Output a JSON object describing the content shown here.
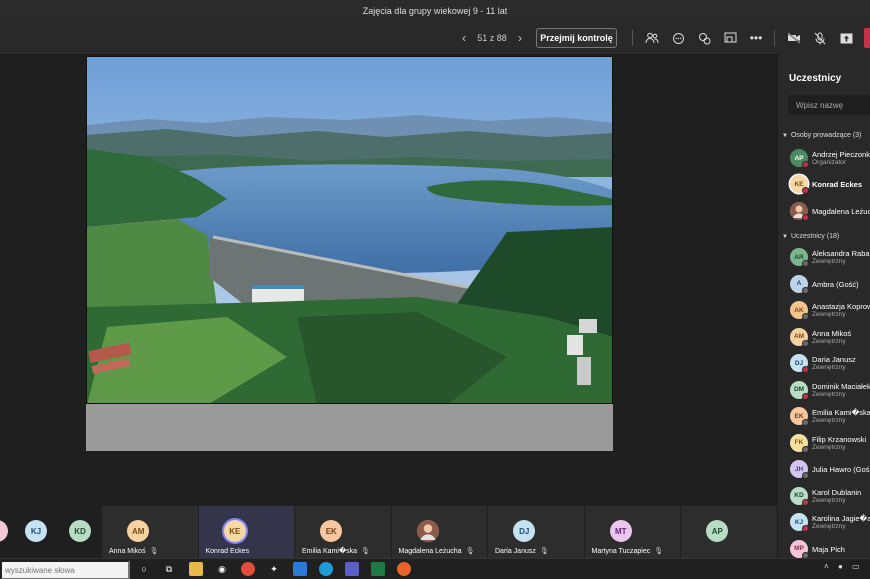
{
  "window": {
    "title": "Zajęcia dla grupy wiekowej 9 - 11 lat"
  },
  "toolbar": {
    "page_count": "51 z 88",
    "take_control": "Przejmij kontrolę",
    "icons": [
      "people-icon",
      "chat-icon",
      "reactions-icon",
      "share-tray-icon",
      "more-icon",
      "camera-off-icon",
      "mic-off-icon",
      "share-icon",
      "leave-icon"
    ]
  },
  "panel": {
    "title": "Uczestnicy",
    "search_placeholder": "Wpisz nazwę",
    "presenters_header": "Osoby prowadzące (3)",
    "presenters": [
      {
        "initials": "AP",
        "name": "Andrzej Pieczonka",
        "role": "Organizator",
        "color": "#4c8a63",
        "fg": "#fff"
      },
      {
        "initials": "KE",
        "name": "Konrad Eckes",
        "role": "",
        "color": "#f6d8a6",
        "fg": "#7a4a10"
      },
      {
        "initials": "",
        "name": "Magdalena Leżuch",
        "role": "",
        "color": "#c98a6a",
        "fg": "#fff"
      }
    ],
    "attendees_header": "Uczestnicy (18)",
    "attendees": [
      {
        "initials": "AR",
        "name": "Aleksandra Raba",
        "role": "Zewnętrzny",
        "color": "#7fb58c",
        "fg": "#1d4a2c"
      },
      {
        "initials": "A",
        "name": "Ambra (Gość)",
        "role": "",
        "color": "#bcd3ea",
        "fg": "#1f4a78"
      },
      {
        "initials": "AK",
        "name": "Anastazja Koprowska",
        "role": "Zewnętrzny",
        "color": "#f3c48e",
        "fg": "#7a4a10"
      },
      {
        "initials": "AM",
        "name": "Anna Mikoś",
        "role": "Zewnętrzny",
        "color": "#f6d2a2",
        "fg": "#7a4a10"
      },
      {
        "initials": "DJ",
        "name": "Daria Janusz",
        "role": "Zewnętrzny",
        "color": "#c6e2f0",
        "fg": "#1f4a78"
      },
      {
        "initials": "DM",
        "name": "Dominik Maciałek",
        "role": "Zewnętrzny",
        "color": "#b8dcc4",
        "fg": "#1d4a2c"
      },
      {
        "initials": "EK",
        "name": "Emilia Kami�ska",
        "role": "Zewnętrzny",
        "color": "#f6c7a0",
        "fg": "#7a3a10"
      },
      {
        "initials": "FK",
        "name": "Filip Krzanowski",
        "role": "Zewnętrzny",
        "color": "#f6e0a0",
        "fg": "#7a5a10"
      },
      {
        "initials": "JH",
        "name": "Julia Hawro (Gość)",
        "role": "",
        "color": "#d2c6ee",
        "fg": "#4a3a88"
      },
      {
        "initials": "KD",
        "name": "Karol Dublanin",
        "role": "Zewnętrzny",
        "color": "#b8dcc4",
        "fg": "#1d4a2c"
      },
      {
        "initials": "KJ",
        "name": "Karolina Jagie�a",
        "role": "Zewnętrzny",
        "color": "#c6e2f0",
        "fg": "#1f4a78"
      },
      {
        "initials": "MP",
        "name": "Maja Pich",
        "role": "",
        "color": "#f3c6d8",
        "fg": "#882a50"
      }
    ]
  },
  "strip": {
    "free": [
      {
        "initials": "KJ",
        "color": "#c6e2f0",
        "fg": "#1f4a78"
      },
      {
        "initials": "KD",
        "color": "#b8dcc4",
        "fg": "#1d4a2c"
      }
    ],
    "tiles": [
      {
        "initials": "AM",
        "name": "Anna Mikoś",
        "color": "#f6d2a2",
        "fg": "#7a4a10"
      },
      {
        "initials": "KE",
        "name": "Konrad Eckes",
        "color": "#f6d8a6",
        "fg": "#7a4a10"
      },
      {
        "initials": "EK",
        "name": "Emilia Kami�ska",
        "color": "#f6c7a0",
        "fg": "#7a3a10"
      },
      {
        "initials": "",
        "name": "Magdalena Leżucha",
        "color": "#c98a6a",
        "fg": "#fff"
      },
      {
        "initials": "DJ",
        "name": "Daria Janusz",
        "color": "#c6e2f0",
        "fg": "#1f4a78"
      },
      {
        "initials": "MT",
        "name": "Martyna Tuczapiec",
        "color": "#eac6ee",
        "fg": "#6a2a78"
      },
      {
        "initials": "AP",
        "name": "",
        "color": "#b8dcc4",
        "fg": "#1d4a2c"
      }
    ]
  },
  "taskbar": {
    "search_placeholder": "wyszukiwane słowa"
  }
}
